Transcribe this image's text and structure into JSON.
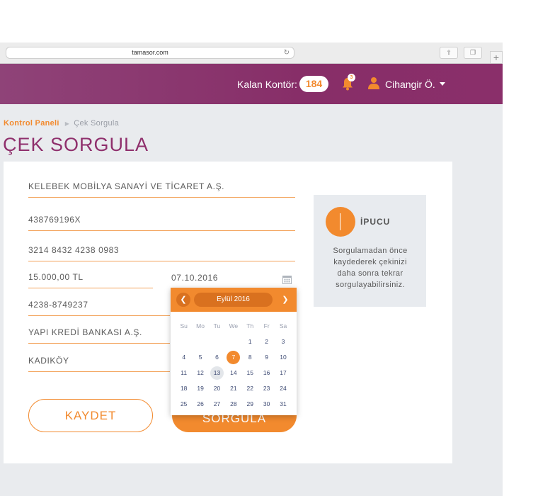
{
  "browser": {
    "url": "tamasor.com"
  },
  "header": {
    "credits_label": "Kalan Kontör:",
    "credits_value": "184",
    "notification_count": "3",
    "user_name": "Cihangir Ö."
  },
  "breadcrumb": {
    "home": "Kontrol Paneli",
    "current": "Çek Sorgula"
  },
  "page": {
    "title": "ÇEK SORGULA"
  },
  "form": {
    "company": "KELEBEK MOBİLYA SANAYİ VE TİCARET A.Ş.",
    "tax_no": "438769196X",
    "cheque_no": "3214 8432 4238 0983",
    "amount": "15.000,00 TL",
    "date": "07.10.2016",
    "account": "4238-8749237",
    "bank": "YAPI KREDİ BANKASI A.Ş.",
    "branch": "KADIKÖY",
    "save_label": "KAYDET",
    "query_label": "SORGULA"
  },
  "tip": {
    "title": "İPUCU",
    "text": "Sorgulamadan önce kaydederek çekinizi daha sonra tekrar sorgulayabilirsiniz."
  },
  "datepicker": {
    "month": "Eylül 2016",
    "weekdays": [
      "Su",
      "Mo",
      "Tu",
      "We",
      "Th",
      "Fr",
      "Sa"
    ],
    "weeks": [
      [
        "",
        "",
        "",
        "",
        "1",
        "2",
        "3"
      ],
      [
        "4",
        "5",
        "6",
        "7",
        "8",
        "9",
        "10"
      ],
      [
        "11",
        "12",
        "13",
        "14",
        "15",
        "16",
        "17"
      ],
      [
        "18",
        "19",
        "20",
        "21",
        "22",
        "23",
        "24"
      ],
      [
        "25",
        "26",
        "27",
        "28",
        "29",
        "30",
        "31"
      ]
    ],
    "selected": "7",
    "today": "13"
  },
  "colors": {
    "brand": "#8a2f6a",
    "accent": "#f28a2e",
    "background": "#e9ebee"
  }
}
